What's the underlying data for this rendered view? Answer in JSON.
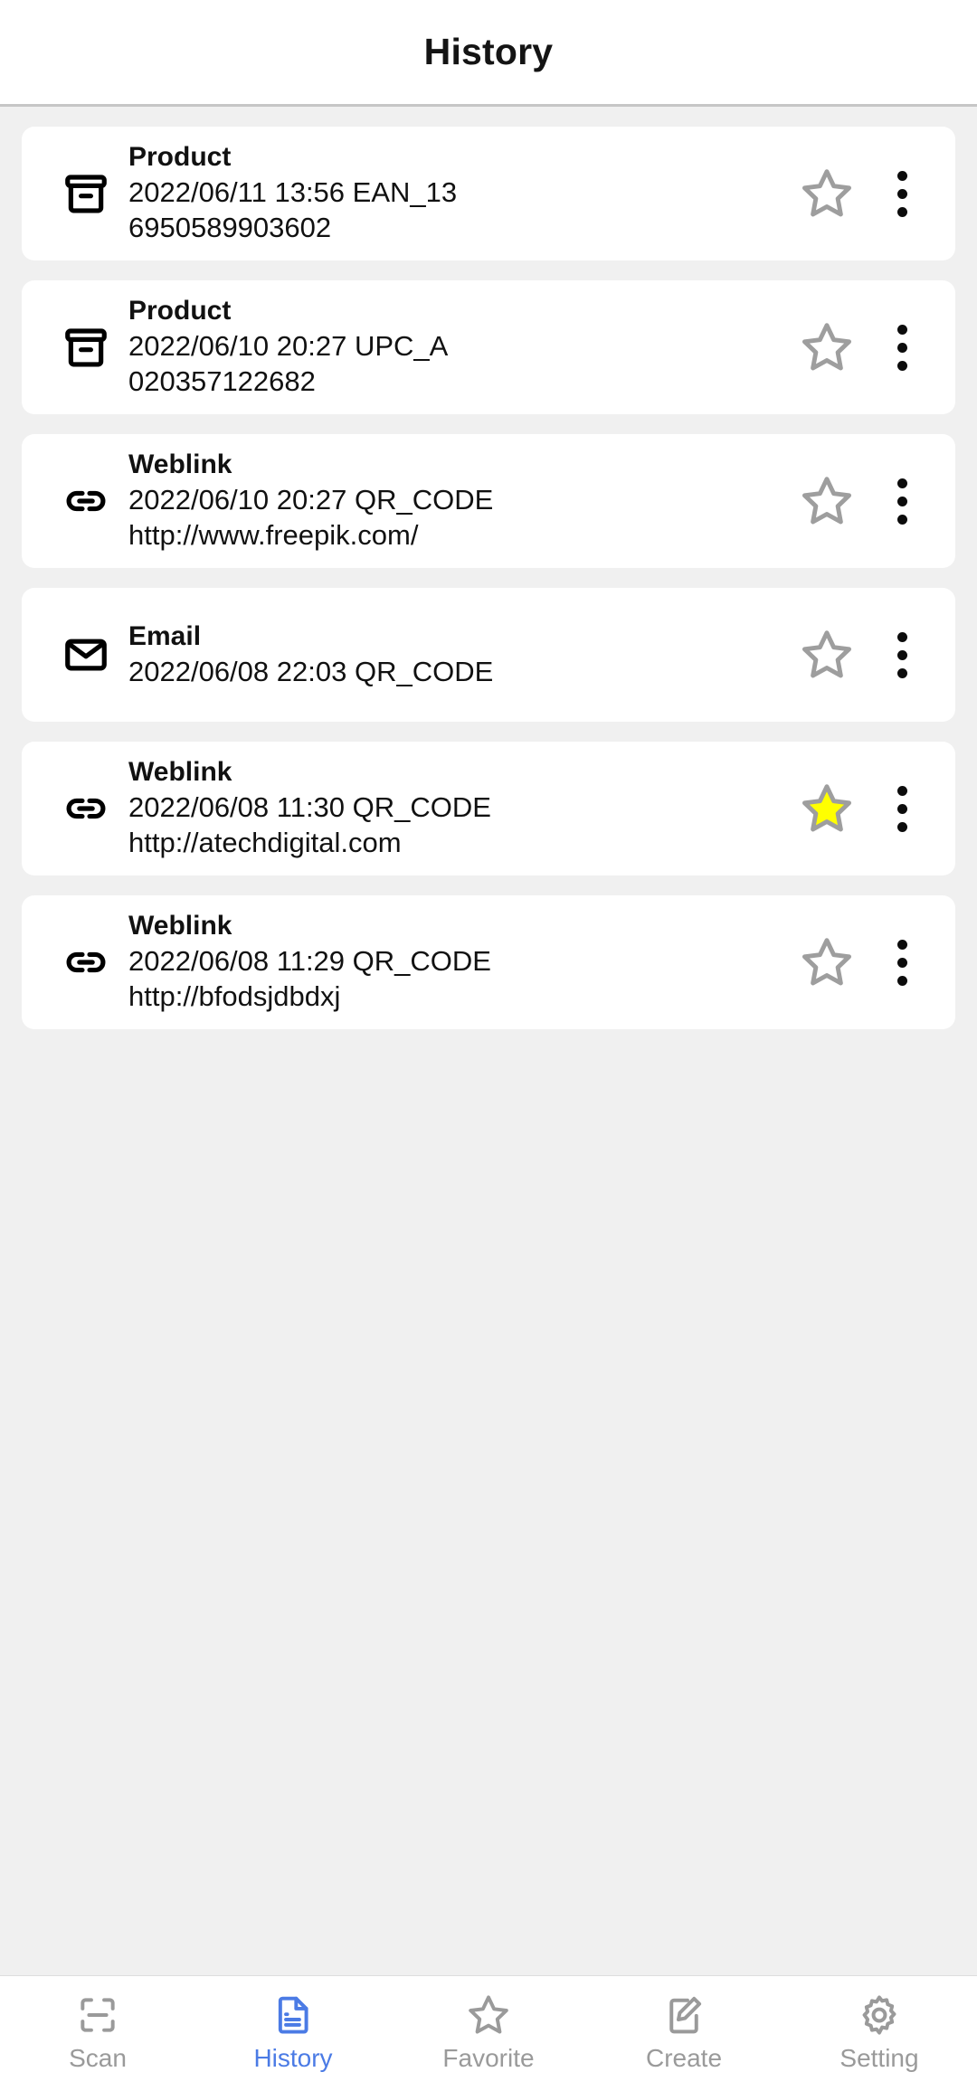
{
  "header": {
    "title": "History"
  },
  "colors": {
    "accent": "#4b7be5",
    "star_filled": "#ffff00",
    "star_outline": "#9e9e9e",
    "page_background": "#f0f0f0",
    "card_background": "#ffffff",
    "text_primary": "#111111",
    "nav_inactive": "#9a9a9a"
  },
  "list": {
    "items": [
      {
        "icon": "box-icon",
        "type": "Product",
        "meta": "2022/06/11 13:56 EAN_13",
        "content": "6950589903602",
        "favorite": false,
        "star_icon": "star-outline-icon",
        "menu_icon": "more-vertical-icon"
      },
      {
        "icon": "box-icon",
        "type": "Product",
        "meta": "2022/06/10 20:27 UPC_A",
        "content": "020357122682",
        "favorite": false,
        "star_icon": "star-outline-icon",
        "menu_icon": "more-vertical-icon"
      },
      {
        "icon": "link-icon",
        "type": "Weblink",
        "meta": "2022/06/10 20:27 QR_CODE",
        "content": "http://www.freepik.com/",
        "favorite": false,
        "star_icon": "star-outline-icon",
        "menu_icon": "more-vertical-icon"
      },
      {
        "icon": "envelope-icon",
        "type": "Email",
        "meta": "2022/06/08 22:03 QR_CODE",
        "content": "",
        "favorite": false,
        "star_icon": "star-outline-icon",
        "menu_icon": "more-vertical-icon"
      },
      {
        "icon": "link-icon",
        "type": "Weblink",
        "meta": "2022/06/08 11:30 QR_CODE",
        "content": "http://atechdigital.com",
        "favorite": true,
        "star_icon": "star-filled-icon",
        "menu_icon": "more-vertical-icon"
      },
      {
        "icon": "link-icon",
        "type": "Weblink",
        "meta": "2022/06/08 11:29 QR_CODE",
        "content": "http://bfodsjdbdxj",
        "favorite": false,
        "star_icon": "star-outline-icon",
        "menu_icon": "more-vertical-icon"
      }
    ]
  },
  "bottom_nav": {
    "active": "History",
    "items": [
      {
        "label": "Scan",
        "icon": "scan-frame-icon",
        "active": false
      },
      {
        "label": "History",
        "icon": "document-icon",
        "active": true
      },
      {
        "label": "Favorite",
        "icon": "star-outline-icon",
        "active": false
      },
      {
        "label": "Create",
        "icon": "edit-pencil-icon",
        "active": false
      },
      {
        "label": "Setting",
        "icon": "gear-icon",
        "active": false
      }
    ]
  }
}
